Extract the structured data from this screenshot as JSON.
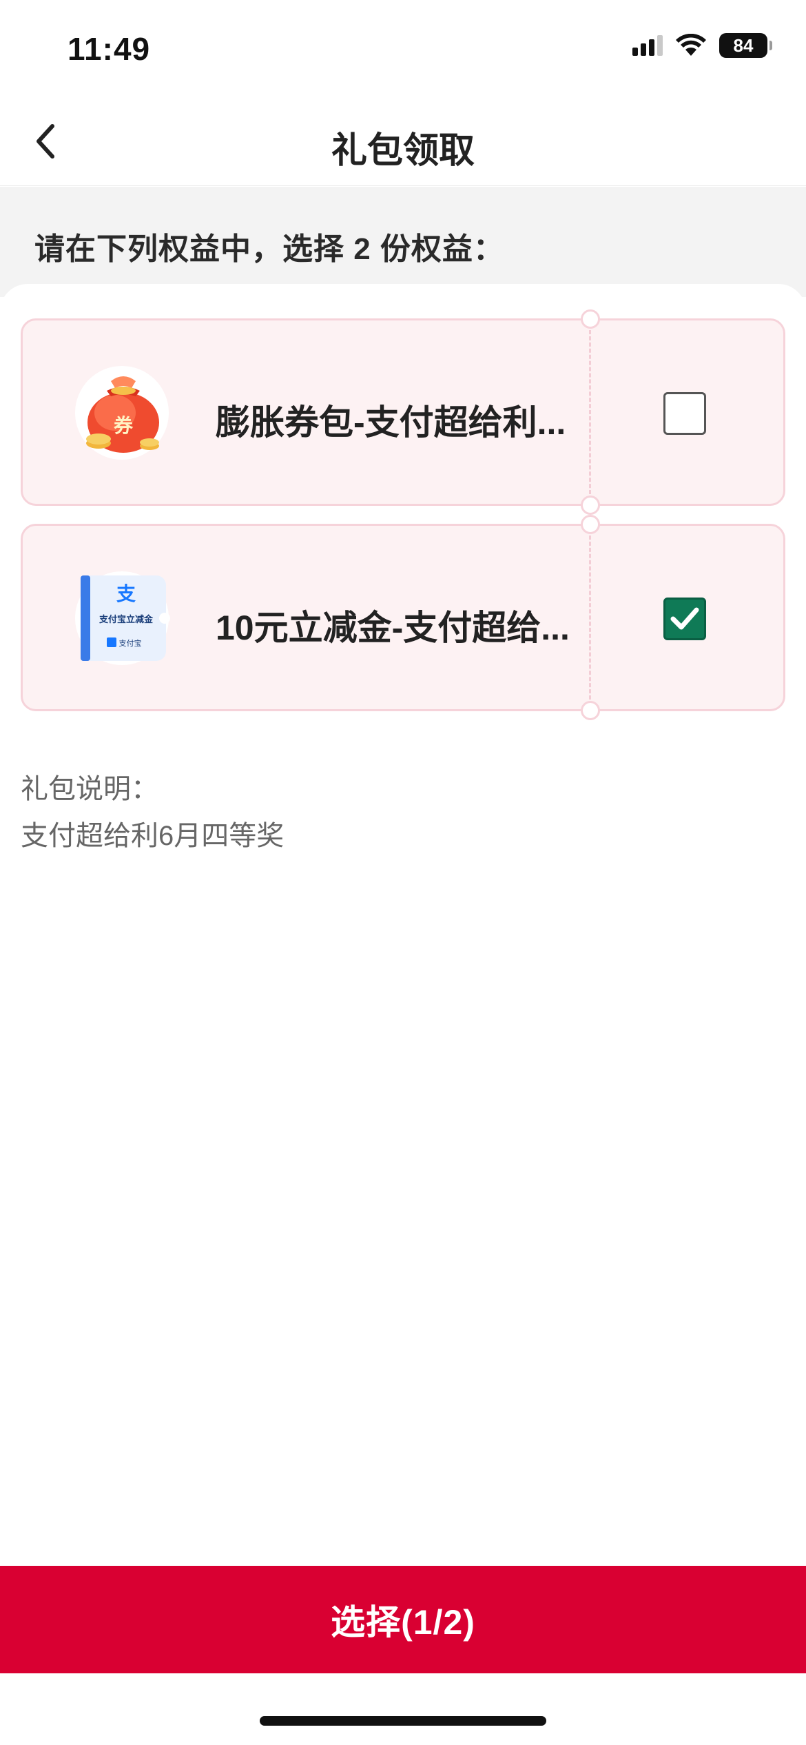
{
  "status_bar": {
    "time": "11:49",
    "battery": "84",
    "icons": [
      "signal-icon",
      "wifi-icon",
      "battery-icon"
    ]
  },
  "nav": {
    "title": "礼包领取",
    "back_icon": "chevron-left-icon"
  },
  "hint": "请在下列权益中，选择 2 份权益：",
  "items": [
    {
      "label": "膨胀券包-支付超给利...",
      "icon": "coupon-bag-icon",
      "icon_text": "券",
      "checked": false
    },
    {
      "label": "10元立减金-支付超给...",
      "icon": "alipay-voucher-icon",
      "icon_text": "支付宝立减金",
      "icon_logo": "支",
      "icon_brand": "支付宝",
      "checked": true
    }
  ],
  "description": {
    "title": "礼包说明：",
    "text": "支付超给利6月四等奖"
  },
  "select_button": "选择(1/2)",
  "colors": {
    "accent": "#d90032",
    "checkbox_checked": "#0f7a56",
    "ticket_bg": "#fdf2f3",
    "ticket_border": "#f6d3da"
  }
}
